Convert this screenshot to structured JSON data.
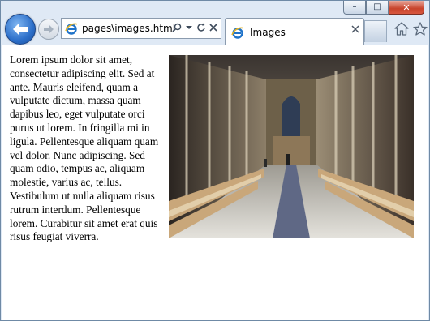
{
  "browser": {
    "address_text": "pages\\images.html",
    "tab_title": "Images",
    "caption": {
      "minimize": "–",
      "maximize": "□",
      "close": "✕"
    }
  },
  "content": {
    "paragraph": "Lorem ipsum dolor sit amet, consectetur adipiscing elit. Sed at ante. Mauris eleifend, quam a vulputate dictum, massa quam dapibus leo, eget vulputate orci purus ut lorem. In fringilla mi in ligula. Pellentesque aliquam quam vel dolor. Nunc adipiscing. Sed quam odio, tempus ac, aliquam molestie, varius ac, tellus. Vestibulum ut nulla aliquam risus rutrum interdum. Pellentesque lorem. Curabitur sit amet erat quis risus feugiat viverra."
  },
  "colors": {
    "accent": "#2c6fc9",
    "frame": "#dfe9f5",
    "close_button": "#c8432b"
  },
  "icons": [
    "back-arrow-icon",
    "forward-arrow-icon",
    "ie-favicon-icon",
    "search-icon",
    "dropdown-icon",
    "refresh-icon",
    "stop-icon",
    "home-icon",
    "favorites-star-icon",
    "minimize-icon",
    "maximize-icon",
    "close-icon"
  ]
}
